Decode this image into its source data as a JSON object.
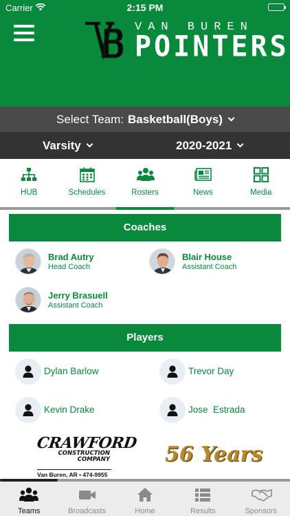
{
  "status_bar": {
    "carrier": "Carrier",
    "time": "2:15 PM"
  },
  "header": {
    "brand_top": "VAN BUREN",
    "brand_main": "POINTERS",
    "logo_letters": "VB",
    "background_color": "#078a3c"
  },
  "selectors": {
    "team_label": "Select Team:",
    "team_value": "Basketball(Boys)",
    "level": "Varsity",
    "season": "2020-2021"
  },
  "tabs": [
    {
      "label": "HUB",
      "icon": "hub-icon"
    },
    {
      "label": "Schedules",
      "icon": "calendar-icon"
    },
    {
      "label": "Rosters",
      "icon": "users-icon",
      "active": true
    },
    {
      "label": "News",
      "icon": "newspaper-icon"
    },
    {
      "label": "Media",
      "icon": "grid-icon"
    }
  ],
  "coaches": {
    "title": "Coaches",
    "items": [
      {
        "name": "Brad Autry",
        "role": "Head Coach"
      },
      {
        "name": "Blair House",
        "role": "Assistant Coach"
      },
      {
        "name": "Jerry Brasuell",
        "role": "Assistant Coach"
      }
    ]
  },
  "players": {
    "title": "Players",
    "items": [
      {
        "name": "Dylan Barlow"
      },
      {
        "name": "Trevor Day"
      },
      {
        "name": "Kevin Drake"
      },
      {
        "name": "Jose  Estrada"
      }
    ]
  },
  "sponsors": {
    "crawford": {
      "line1": "CRAWFORD",
      "line2": "CONSTRUCTION",
      "line3": "COMPANY",
      "line4": "Van Buren, AR • 474-9955"
    },
    "years": "56 Years"
  },
  "bottom_tabs": [
    {
      "label": "Teams",
      "icon": "teams-icon",
      "active": true
    },
    {
      "label": "Broadcasts",
      "icon": "video-camera-icon"
    },
    {
      "label": "Home",
      "icon": "home-icon"
    },
    {
      "label": "Results",
      "icon": "list-icon"
    },
    {
      "label": "Sponsors",
      "icon": "handshake-icon"
    }
  ],
  "colors": {
    "accent": "#078a3c",
    "selector_dark": "#333333",
    "selector_mid": "#4a4a4a"
  }
}
